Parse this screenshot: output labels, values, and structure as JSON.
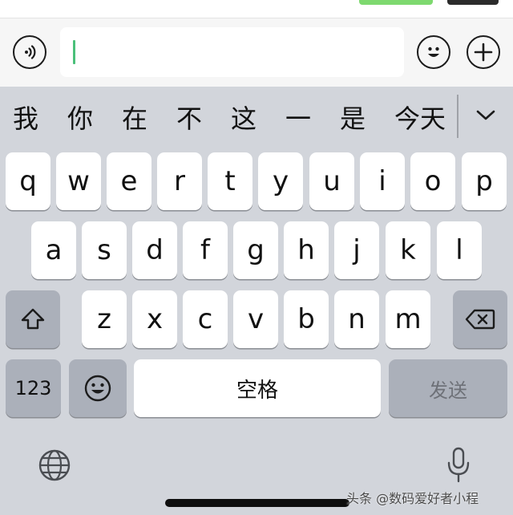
{
  "input_bar": {
    "text_value": "",
    "voice_icon": "voice-icon",
    "emoji_icon": "emoji-icon",
    "plus_icon": "plus-icon"
  },
  "candidates": {
    "items": [
      "我",
      "你",
      "在",
      "不",
      "这",
      "一",
      "是",
      "今天"
    ],
    "expand_icon": "chevron-down-icon"
  },
  "keyboard": {
    "row1": [
      "q",
      "w",
      "e",
      "r",
      "t",
      "y",
      "u",
      "i",
      "o",
      "p"
    ],
    "row2": [
      "a",
      "s",
      "d",
      "f",
      "g",
      "h",
      "j",
      "k",
      "l"
    ],
    "row3": [
      "z",
      "x",
      "c",
      "v",
      "b",
      "n",
      "m"
    ],
    "shift_icon": "shift-icon",
    "delete_icon": "delete-icon",
    "numbers_label": "123",
    "emoji_icon": "emoji-icon",
    "space_label": "空格",
    "send_label": "发送"
  },
  "bottom_bar": {
    "globe_icon": "globe-icon",
    "mic_icon": "microphone-icon"
  },
  "watermark": "头条 @数码爱好者小程"
}
